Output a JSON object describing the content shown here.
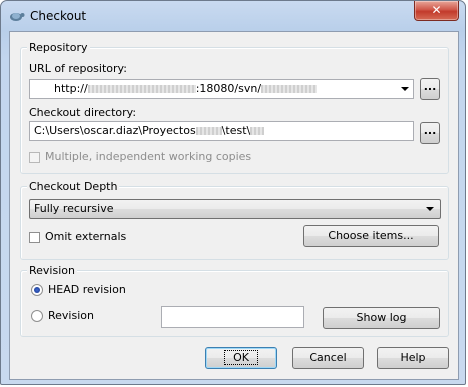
{
  "window": {
    "title": "Checkout",
    "close_glyph": "✕"
  },
  "repository": {
    "group_title": "Repository",
    "url_label": "URL of repository:",
    "url_value_prefix": "http://",
    "url_value_middle": ":18080/svn/",
    "dir_label": "Checkout directory:",
    "dir_value_prefix": "C:\\Users\\oscar.diaz\\Proyectos",
    "dir_value_middle": "\\test\\",
    "browse_label": "...",
    "multiple_label": "Multiple, independent working copies"
  },
  "depth": {
    "group_title": "Checkout Depth",
    "selected": "Fully recursive",
    "omit_label": "Omit externals",
    "choose_label": "Choose items..."
  },
  "revision": {
    "group_title": "Revision",
    "head_label": "HEAD revision",
    "revision_label": "Revision",
    "revision_value": "",
    "show_log_label": "Show log"
  },
  "buttons": {
    "ok": "OK",
    "cancel": "Cancel",
    "help": "Help"
  },
  "icons": {
    "app": "tortoise-icon",
    "close": "close-icon",
    "dropdown": "chevron-down-icon"
  }
}
